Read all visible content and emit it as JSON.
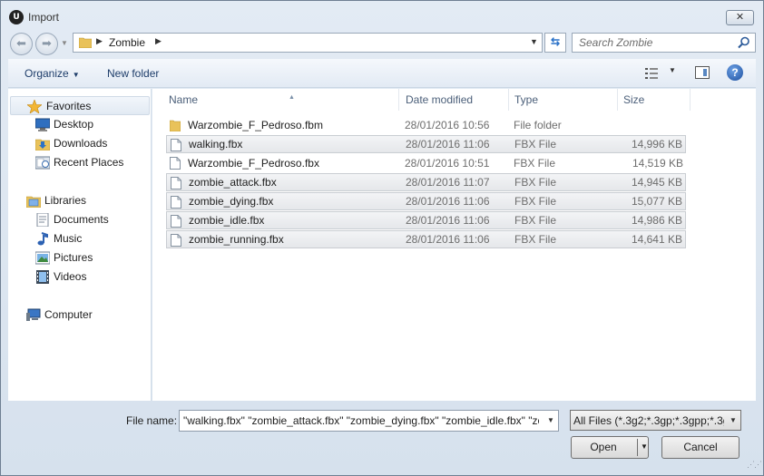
{
  "window": {
    "title": "Import",
    "app_icon_text": "U",
    "close_glyph": "✕"
  },
  "address": {
    "crumb": "Zombie",
    "back_glyph": "⬅",
    "forward_glyph": "➡",
    "refresh_glyph": "⇆"
  },
  "search": {
    "placeholder": "Search Zombie"
  },
  "toolbar": {
    "organize_label": "Organize",
    "new_folder_label": "New folder",
    "help_glyph": "?"
  },
  "nav": {
    "favorites": "Favorites",
    "desktop": "Desktop",
    "downloads": "Downloads",
    "recent_places": "Recent Places",
    "libraries": "Libraries",
    "documents": "Documents",
    "music": "Music",
    "pictures": "Pictures",
    "videos": "Videos",
    "computer": "Computer"
  },
  "columns": {
    "name": "Name",
    "date": "Date modified",
    "type": "Type",
    "size": "Size"
  },
  "files": [
    {
      "name": "Warzombie_F_Pedroso.fbm",
      "date": "28/01/2016 10:56",
      "type": "File folder",
      "size": "",
      "is_folder": true,
      "selected": false
    },
    {
      "name": "walking.fbx",
      "date": "28/01/2016 11:06",
      "type": "FBX File",
      "size": "14,996 KB",
      "is_folder": false,
      "selected": true
    },
    {
      "name": "Warzombie_F_Pedroso.fbx",
      "date": "28/01/2016 10:51",
      "type": "FBX File",
      "size": "14,519 KB",
      "is_folder": false,
      "selected": false
    },
    {
      "name": "zombie_attack.fbx",
      "date": "28/01/2016 11:07",
      "type": "FBX File",
      "size": "14,945 KB",
      "is_folder": false,
      "selected": true
    },
    {
      "name": "zombie_dying.fbx",
      "date": "28/01/2016 11:06",
      "type": "FBX File",
      "size": "15,077 KB",
      "is_folder": false,
      "selected": true
    },
    {
      "name": "zombie_idle.fbx",
      "date": "28/01/2016 11:06",
      "type": "FBX File",
      "size": "14,986 KB",
      "is_folder": false,
      "selected": true
    },
    {
      "name": "zombie_running.fbx",
      "date": "28/01/2016 11:06",
      "type": "FBX File",
      "size": "14,641 KB",
      "is_folder": false,
      "selected": true
    }
  ],
  "bottom": {
    "filename_label": "File name:",
    "filename_value": "\"walking.fbx\" \"zombie_attack.fbx\" \"zombie_dying.fbx\" \"zombie_idle.fbx\" \"zo",
    "filter_value": "All Files (*.3g2;*.3gp;*.3gpp;*.3g",
    "open_label": "Open",
    "cancel_label": "Cancel"
  }
}
